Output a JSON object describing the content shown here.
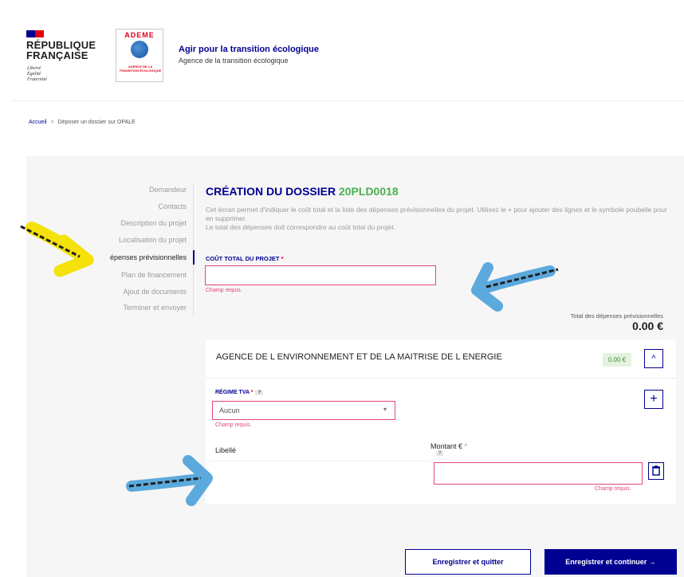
{
  "header": {
    "republic_title": "RÉPUBLIQUE\nFRANÇAISE",
    "republic_motto": "Liberté\nÉgalité\nFraternité",
    "agency_logo_word": "ADEME",
    "agency_logo_sub": "AGENCE DE LA TRANSITION ÉCOLOGIQUE",
    "title": "Agir pour la transition écologique",
    "subtitle": "Agence de la transition écologique"
  },
  "breadcrumb": {
    "home": "Accueil",
    "separator": ">",
    "current": "Déposer un dossier sur OPALE"
  },
  "sidebar": {
    "items": [
      {
        "label": "Demandeur"
      },
      {
        "label": "Contacts"
      },
      {
        "label": "Description du projet"
      },
      {
        "label": "Localisation du projet"
      },
      {
        "label": "épenses prévisionnelles"
      },
      {
        "label": "Plan de financement"
      },
      {
        "label": "Ajout de documents"
      },
      {
        "label": "Terminer et envoyer"
      }
    ]
  },
  "main": {
    "title_prefix": "CRÉATION DU DOSSIER ",
    "title_code": "20PLD0018",
    "description": "Cet écran permet d'indiquer le coût total et la liste des dépenses prévisionnelles du projet. Utilisez le + pour ajouter des lignes et le symbole poubelle pour en supprimer.\nLe total des dépenses doit correspondre au coût total du projet.",
    "cout_label": "COÛT TOTAL DU PROJET",
    "required_mark": "*",
    "cout_value": "",
    "cout_error": "Champ requis.",
    "total_label": "Total des dépenses prévisionnelles",
    "total_value": "0.00 €"
  },
  "card": {
    "title": "AGENCE DE L ENVIRONNEMENT ET DE LA MAITRISE DE L ENERGIE",
    "badge": "0.00 €",
    "collapse_icon": "^",
    "tva_label": "RÉGIME TVA",
    "tva_required": "*",
    "help_mark": "?",
    "tva_value": "Aucun",
    "tva_arrow": "▾",
    "tva_error": "Champ requis.",
    "add_icon": "+",
    "col_libelle": "Libellé",
    "col_montant": "Montant €",
    "col_montant_req": "*",
    "montant_value": "",
    "montant_error": "Champ requis."
  },
  "buttons": {
    "save_quit": "Enregistrer et quitter",
    "save_continue": "Enregistrer et continuer →"
  },
  "colors": {
    "primary": "#000091",
    "error": "#e0477a",
    "success": "#4caf50",
    "arrow_yellow": "#f4e20a",
    "arrow_blue": "#5ba9dd"
  }
}
